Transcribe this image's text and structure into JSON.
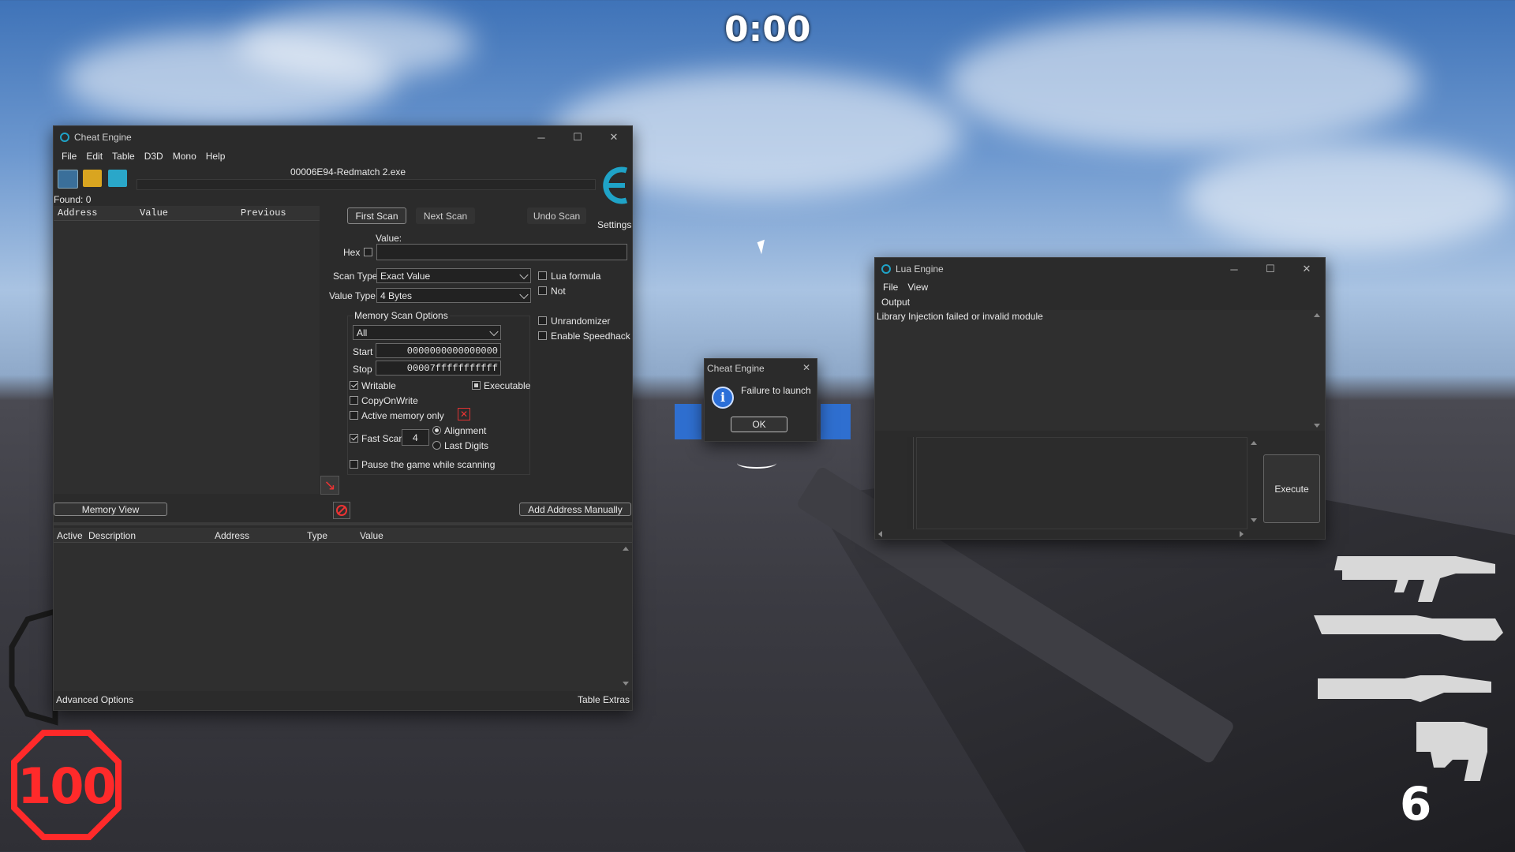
{
  "game": {
    "timer": "0:00",
    "health": "100",
    "ammo": "6"
  },
  "ce": {
    "title": "Cheat Engine",
    "menu": [
      "File",
      "Edit",
      "Table",
      "D3D",
      "Mono",
      "Help"
    ],
    "process": "00006E94-Redmatch 2.exe",
    "found": "Found: 0",
    "cols": {
      "address": "Address",
      "value": "Value",
      "previous": "Previous"
    },
    "first_scan": "First Scan",
    "next_scan": "Next Scan",
    "undo_scan": "Undo Scan",
    "settings": "Settings",
    "value_label": "Value:",
    "hex": "Hex",
    "scan_type_label": "Scan Type",
    "scan_type": "Exact Value",
    "value_type_label": "Value Type",
    "value_type": "4 Bytes",
    "lua_formula": "Lua formula",
    "not": "Not",
    "unrandomizer": "Unrandomizer",
    "speedhack": "Enable Speedhack",
    "mem_opts": "Memory Scan Options",
    "region": "All",
    "start_label": "Start",
    "start": "0000000000000000",
    "stop_label": "Stop",
    "stop": "00007fffffffffff",
    "writable": "Writable",
    "executable": "Executable",
    "copyonwrite": "CopyOnWrite",
    "active_only": "Active memory only",
    "fast_scan": "Fast Scan",
    "fast_val": "4",
    "alignment": "Alignment",
    "last_digits": "Last Digits",
    "pause": "Pause the game while scanning",
    "memory_view": "Memory View",
    "add_manual": "Add Address Manually",
    "table_cols": {
      "active": "Active",
      "description": "Description",
      "address": "Address",
      "type": "Type",
      "value": "Value"
    },
    "advanced": "Advanced Options",
    "extras": "Table Extras"
  },
  "dialog": {
    "title": "Cheat Engine",
    "message": "Failure to launch",
    "ok": "OK"
  },
  "lua": {
    "title": "Lua Engine",
    "menu": [
      "File",
      "View"
    ],
    "output_label": "Output",
    "output": "Library Injection failed or invalid module",
    "execute": "Execute"
  },
  "colors": {
    "accent": "#1fa3c7",
    "health": "#ff2a2a"
  }
}
